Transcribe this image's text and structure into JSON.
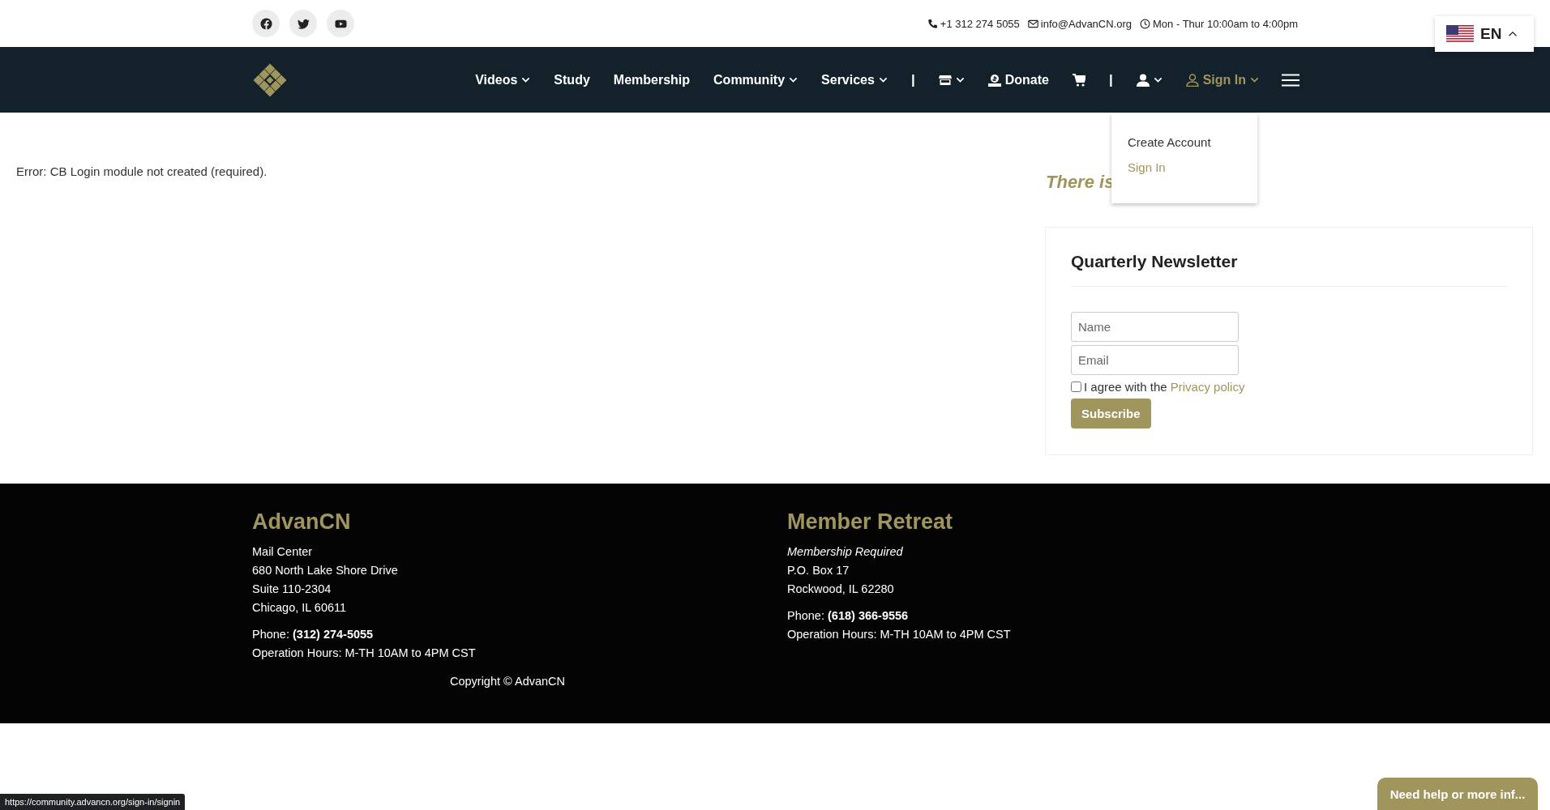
{
  "topbar": {
    "social": [
      {
        "kind": "facebook"
      },
      {
        "kind": "twitter"
      },
      {
        "kind": "youtube"
      }
    ],
    "contacts": [
      {
        "kind": "phone",
        "text": "+1 312 274 5055"
      },
      {
        "kind": "email",
        "text": "info@AdvanCN.org"
      },
      {
        "kind": "clock",
        "text": "Mon - Thur 10:00am to 4:00pm"
      }
    ]
  },
  "language": {
    "code": "EN",
    "expanded": true
  },
  "nav": {
    "items": [
      {
        "kind": "link",
        "label": "Videos",
        "dropdown": true,
        "selected": false
      },
      {
        "kind": "link",
        "label": "Study",
        "dropdown": false,
        "selected": false
      },
      {
        "kind": "link",
        "label": "Membership",
        "dropdown": false,
        "selected": false
      },
      {
        "kind": "link",
        "label": "Community",
        "dropdown": true,
        "selected": false
      },
      {
        "kind": "link",
        "label": "Services",
        "dropdown": true,
        "selected": false
      },
      {
        "kind": "separator",
        "label": "|"
      },
      {
        "kind": "store",
        "dropdown": true,
        "selected": false
      },
      {
        "kind": "donate",
        "label": "Donate",
        "dropdown": false,
        "selected": false
      },
      {
        "kind": "cart",
        "dropdown": false,
        "selected": false
      },
      {
        "kind": "separator",
        "label": "|"
      },
      {
        "kind": "account",
        "dropdown": true,
        "selected": false
      },
      {
        "kind": "signin",
        "label": "Sign In",
        "dropdown": true,
        "selected": true
      }
    ]
  },
  "dropdown_menu": {
    "items": [
      {
        "label": "Create Account",
        "selected": false
      },
      {
        "label": "Sign In",
        "selected": true
      }
    ]
  },
  "main": {
    "error": "Error: CB Login module not created (required).",
    "aside_heading": "There is"
  },
  "newsletter": {
    "title": "Quarterly Newsletter",
    "fields": [
      {
        "placeholder": "Name"
      },
      {
        "placeholder": "Email"
      }
    ],
    "consent": {
      "checked": false,
      "text": "I agree with the",
      "link": "Privacy policy"
    },
    "button": "Subscribe"
  },
  "footer": {
    "columns": [
      {
        "title": "AdvanCN",
        "blocks": [
          [
            {
              "kind": "plain",
              "text": "Mail Center"
            },
            {
              "kind": "plain",
              "text": "680 North Lake Shore Drive"
            },
            {
              "kind": "plain",
              "text": "Suite 110-2304"
            },
            {
              "kind": "plain",
              "text": "Chicago, IL 60611"
            }
          ],
          [
            {
              "kind": "plain",
              "text": "Phone: **(312) 274-5055**"
            },
            {
              "kind": "plain",
              "text": "Operation Hours: M-TH 10AM to 4PM CST"
            }
          ]
        ],
        "copyright": "Copyright © AdvanCN"
      },
      {
        "title": "Member Retreat",
        "blocks": [
          [
            {
              "kind": "italic",
              "text": "Membership Required"
            },
            {
              "kind": "plain",
              "text": "P.O. Box 17"
            },
            {
              "kind": "plain",
              "text": "Rockwood, IL 62280"
            }
          ],
          [
            {
              "kind": "plain",
              "text": "Phone: **(618) 366-9556**"
            },
            {
              "kind": "plain",
              "text": "Operation Hours: M-TH 10AM to 4PM CST"
            }
          ]
        ]
      }
    ]
  },
  "status_url": "https://community.advancn.org/sign-in/signin",
  "chat_button": "Need help or more inf..."
}
